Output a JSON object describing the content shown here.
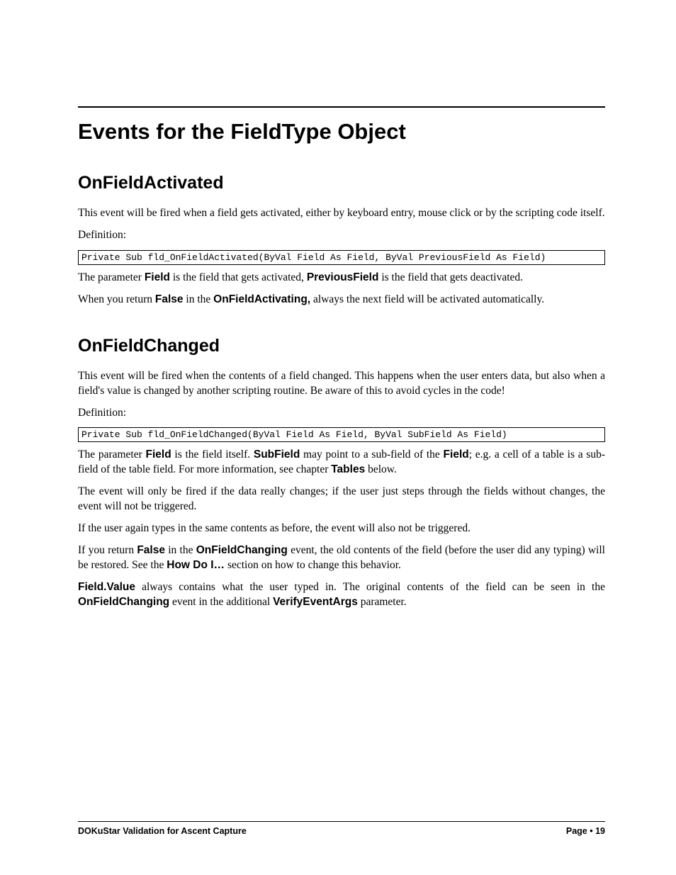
{
  "title": "Events for the FieldType Object",
  "section1": {
    "heading": "OnFieldActivated",
    "p1": "This event will be fired when a field gets activated, either by keyboard entry, mouse click or by the scripting code itself.",
    "defLabel": "Definition:",
    "code": "Private Sub fld_OnFieldActivated(ByVal Field As Field, ByVal PreviousField As Field)",
    "p2_a": "The parameter ",
    "p2_b": "Field",
    "p2_c": " is the field that gets activated, ",
    "p2_d": "PreviousField",
    "p2_e": " is the field that gets deactivated.",
    "p3_a": "When you return ",
    "p3_b": "False",
    "p3_c": " in the ",
    "p3_d": "OnFieldActivating,",
    "p3_e": " always the next field will be activated automatically."
  },
  "section2": {
    "heading": "OnFieldChanged",
    "p1": "This event will be fired when the contents of a field changed. This happens when the user enters data, but also when a field's value is changed by another scripting routine. Be aware of this to avoid cycles in the code!",
    "defLabel": "Definition:",
    "code": "Private Sub fld_OnFieldChanged(ByVal Field As Field, ByVal SubField As Field)",
    "p2_a": "The parameter ",
    "p2_b": "Field",
    "p2_c": " is the field itself. ",
    "p2_d": "SubField",
    "p2_e": " may point to a sub-field of the ",
    "p2_f": "Field",
    "p2_g": "; e.g. a cell of a table is a sub-field of the table field. For more information, see chapter ",
    "p2_h": "Tables",
    "p2_i": " below.",
    "p3": "The event will only be fired if the data really changes; if the user just steps through the fields without changes, the event will not be triggered.",
    "p4": "If the user again types in the same contents as before, the event will also not be triggered.",
    "p5_a": "If you return ",
    "p5_b": "False",
    "p5_c": " in the ",
    "p5_d": "OnFieldChanging",
    "p5_e": " event, the old contents of the field (before the user did any typing) will be restored. See the  ",
    "p5_f": "How Do I…",
    "p5_g": "  section on how to change this behavior.",
    "p6_a": "Field.Value",
    "p6_b": "  always  contains  what  the  user  typed  in.  The  original  contents  of  the  field  can  be  seen  in  the ",
    "p6_c": "OnFieldChanging",
    "p6_d": "  event in the additional ",
    "p6_e": "VerifyEventArgs",
    "p6_f": " parameter."
  },
  "footer": {
    "left": "DOKuStar Validation for Ascent Capture",
    "rightLabel": "Page",
    "pageNum": "19"
  }
}
